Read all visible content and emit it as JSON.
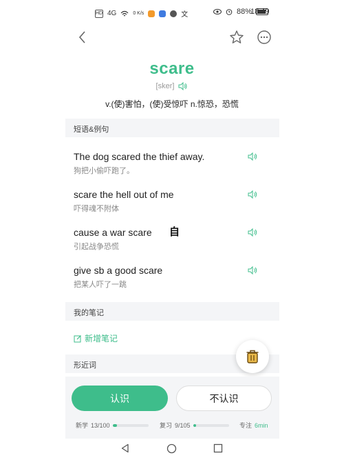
{
  "status_bar": {
    "signal_text": "4G",
    "net_speed": "0 K/s",
    "battery_pct": "88%",
    "time": "18:49"
  },
  "word": {
    "headword": "scare",
    "phonetic": "[sker]",
    "definition": "v.(使)害怕，(使)受惊吓 n.惊恐，恐慌"
  },
  "sections": {
    "phrases_title": "短语&例句",
    "notes_title": "我的笔记",
    "similar_title": "形近词"
  },
  "phrases": [
    {
      "en": "The dog scared the thief away.",
      "cn": "狗把小偷吓跑了。"
    },
    {
      "en": "scare the hell out of me",
      "cn": "吓得魂不附体"
    },
    {
      "en": "cause a war scare",
      "cn": "引起战争恐慌"
    },
    {
      "en": "give sb a good scare",
      "cn": "把某人吓了一跳"
    }
  ],
  "overlay_char": "自",
  "notes": {
    "add_label": "新增笔记"
  },
  "actions": {
    "know_label": "认识",
    "unknown_label": "不认识"
  },
  "progress": {
    "new_label": "新学",
    "new_count": "13/100",
    "new_fraction": 0.13,
    "review_label": "复习",
    "review_count": "9/105",
    "review_fraction": 0.086,
    "focus_label": "专注",
    "focus_time": "6min"
  },
  "colors": {
    "accent": "#3ebd8b",
    "section_bg": "#f4f5f7"
  },
  "icons": [
    "back-arrow-icon",
    "star-icon",
    "more-icon",
    "speaker-icon",
    "edit-icon",
    "trash-icon",
    "nav-back-icon",
    "nav-home-icon",
    "nav-recent-icon"
  ]
}
